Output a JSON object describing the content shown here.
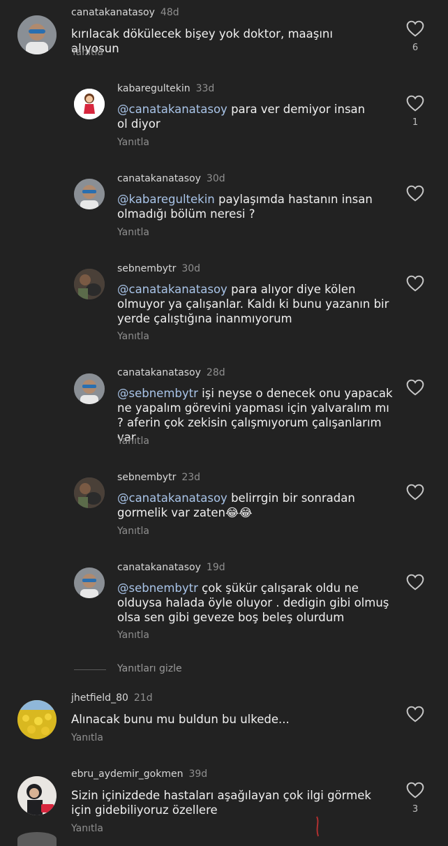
{
  "comments": [
    {
      "username": "canatakanatasoy",
      "time": "48d",
      "mention": "",
      "text": "kırılacak dökülecek bişey yok doktor, maaşını alıyosun",
      "reply_label": "Yanıtla",
      "likes": "6",
      "avatar": "man-sunglasses"
    },
    {
      "username": "kabaregultekin",
      "time": "33d",
      "mention": "@canatakanatasoy",
      "text": " para ver demiyor insan ol diyor",
      "reply_label": "Yanıtla",
      "likes": "1",
      "avatar": "cartoon-girl"
    },
    {
      "username": "canatakanatasoy",
      "time": "30d",
      "mention": "@kabaregultekin",
      "text": " paylaşımda hastanın insan olmadığı bölüm neresi ?",
      "reply_label": "Yanıtla",
      "likes": "",
      "avatar": "man-sunglasses"
    },
    {
      "username": "sebnembytr",
      "time": "30d",
      "mention": "@canatakanatasoy",
      "text": " para alıyor diye kölen olmuyor ya çalışanlar. Kaldı ki bunu yazanın bir yerde çalıştığına inanmıyorum",
      "reply_label": "Yanıtla",
      "likes": "",
      "avatar": "woman-dog"
    },
    {
      "username": "canatakanatasoy",
      "time": "28d",
      "mention": "@sebnembytr",
      "text": " işi neyse o denecek onu yapacak ne yapalım görevini yapması için yalvaralım mı ? aferin çok zekisin çalışmıyorum  çalışanlarım var",
      "reply_label": "Yanıtla",
      "likes": "",
      "avatar": "man-sunglasses"
    },
    {
      "username": "sebnembytr",
      "time": "23d",
      "mention": "@canatakanatasoy",
      "text": " belirrgin bir sonradan gormelik var zaten😂😂",
      "reply_label": "Yanıtla",
      "likes": "",
      "avatar": "woman-dog"
    },
    {
      "username": "canatakanatasoy",
      "time": "19d",
      "mention": "@sebnembytr",
      "text": " çok şükür çalışarak oldu ne olduysa halada öyle oluyor . dedigin gibi olmuş olsa sen gibi geveze boş beleş olurdum",
      "reply_label": "Yanıtla",
      "likes": "",
      "avatar": "man-sunglasses"
    },
    {
      "username": "jhetfield_80",
      "time": "21d",
      "mention": "",
      "text": "Alınacak bunu mu buldun bu ulkede...",
      "reply_label": "Yanıtla",
      "likes": "",
      "avatar": "sunflower-field"
    },
    {
      "username": "ebru_aydemir_gokmen",
      "time": "39d",
      "mention": "",
      "text": "Sizin içinizdede hastaları aşağılayan çok ilgi görmek için gidebiliyoruz özellere",
      "reply_label": "Yanıtla",
      "likes": "3",
      "avatar": "woman-headscarf"
    }
  ],
  "hide_replies_label": "Yanıtları gizle",
  "colors": {
    "background": "#222222",
    "mention": "#a9c4e8",
    "muted": "#8f8f8f"
  }
}
